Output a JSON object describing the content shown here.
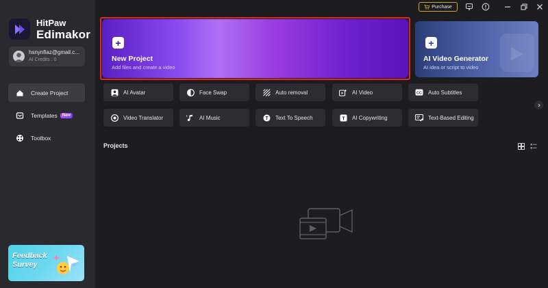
{
  "sidebar": {
    "brand_top": "HitPaw",
    "brand_bottom": "Edimakor",
    "account_email": "hsnynfiaz@gmail.c...",
    "account_credits": "AI Credits : 0",
    "nav": [
      {
        "label": "Create Project",
        "icon": "home-icon"
      },
      {
        "label": "Templates",
        "icon": "templates-icon",
        "badge": "New"
      },
      {
        "label": "Toolbox",
        "icon": "toolbox-icon"
      }
    ],
    "feedback_line1": "Feedback",
    "feedback_line2": "Survey"
  },
  "topbar": {
    "purchase_label": "Purchase"
  },
  "hero": {
    "new_project_title": "New Project",
    "new_project_sub": "Add files and create a video",
    "ai_video_title": "AI Video Generator",
    "ai_video_sub": "AI idea or script to video"
  },
  "tools_row1": [
    {
      "label": "AI Avatar",
      "icon": "avatar-icon"
    },
    {
      "label": "Face Swap",
      "icon": "face-swap-icon"
    },
    {
      "label": "Auto removal",
      "icon": "auto-removal-icon"
    },
    {
      "label": "AI Video",
      "icon": "ai-video-icon"
    },
    {
      "label": "Auto Subtitles",
      "icon": "subtitles-icon"
    }
  ],
  "tools_row2": [
    {
      "label": "Video Translator",
      "icon": "translator-icon"
    },
    {
      "label": "AI Music",
      "icon": "music-icon"
    },
    {
      "label": "Text To Speech",
      "icon": "text-to-speech-icon"
    },
    {
      "label": "AI Copywriting",
      "icon": "copywriting-icon"
    },
    {
      "label": "Text-Based Editing",
      "icon": "text-editing-icon"
    }
  ],
  "projects": {
    "title": "Projects"
  },
  "colors": {
    "accent": "#8a4bf0",
    "selection_border": "#e0262c",
    "purchase_border": "#d4a43a"
  }
}
